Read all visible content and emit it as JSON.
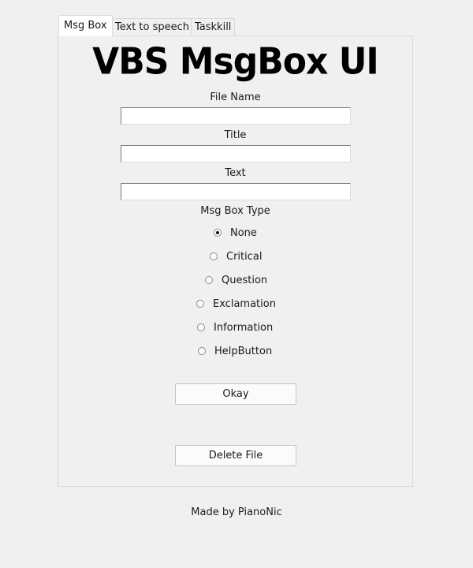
{
  "tabs": [
    {
      "label": "Msg Box",
      "active": true
    },
    {
      "label": "Text to speech",
      "active": false
    },
    {
      "label": "Taskkill",
      "active": false
    }
  ],
  "msgbox": {
    "banner": "VBS MsgBox UI",
    "file_name_label": "File Name",
    "file_name_value": "",
    "title_label": "Title",
    "title_value": "",
    "text_label": "Text",
    "text_value": "",
    "type_label": "Msg Box Type",
    "types": [
      {
        "label": "None",
        "selected": true
      },
      {
        "label": "Critical",
        "selected": false
      },
      {
        "label": "Question",
        "selected": false
      },
      {
        "label": "Exclamation",
        "selected": false
      },
      {
        "label": "Information",
        "selected": false
      },
      {
        "label": "HelpButton",
        "selected": false
      }
    ],
    "okay_button": "Okay",
    "delete_button": "Delete File"
  },
  "footer": "Made by PianoNic"
}
